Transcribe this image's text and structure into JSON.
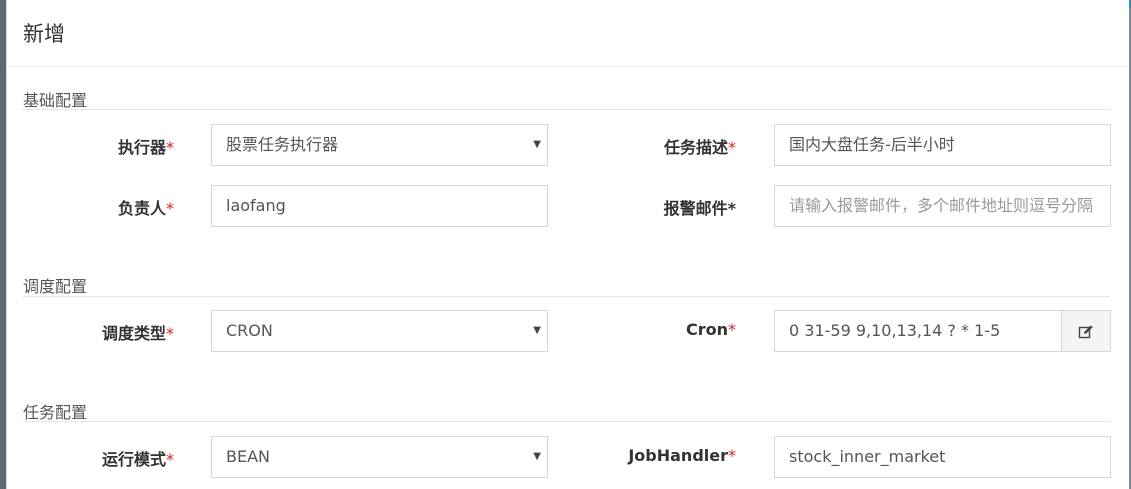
{
  "modal": {
    "title": "新增"
  },
  "sections": {
    "basic": "基础配置",
    "schedule": "调度配置",
    "task": "任务配置"
  },
  "fields": {
    "executor": {
      "label": "执行器",
      "value": "股票任务执行器"
    },
    "task_desc": {
      "label": "任务描述",
      "value": "国内大盘任务-后半小时"
    },
    "owner": {
      "label": "负责人",
      "value": "laofang"
    },
    "alarm_email": {
      "label": "报警邮件",
      "placeholder": "请输入报警邮件，多个邮件地址则逗号分隔"
    },
    "schedule_type": {
      "label": "调度类型",
      "value": "CRON"
    },
    "cron": {
      "label": "Cron",
      "value": "0 31-59 9,10,13,14 ? * 1-5"
    },
    "run_mode": {
      "label": "运行模式",
      "value": "BEAN"
    },
    "job_handler": {
      "label": "JobHandler",
      "value": "stock_inner_market"
    }
  },
  "required_mark": "*",
  "icons": {
    "cron_editor": "edit-icon",
    "select_caret": "caret-down-icon"
  }
}
